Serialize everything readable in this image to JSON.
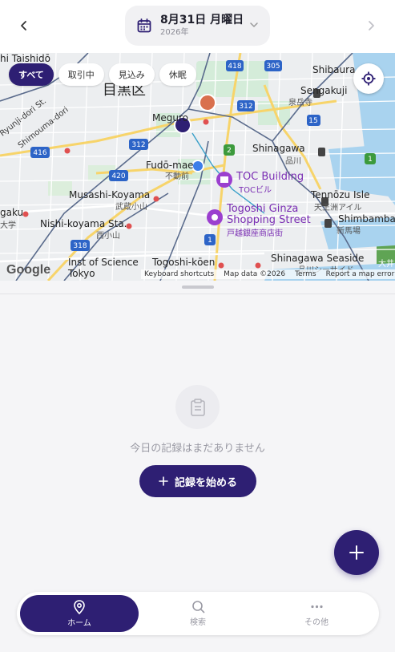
{
  "header": {
    "date": "8月31日 月曜日",
    "year": "2026年"
  },
  "filters": [
    "すべて",
    "取引中",
    "見込み",
    "休眠"
  ],
  "map": {
    "labels": {
      "taishido": "hi Taishidō",
      "meguro_ku": "目黒区",
      "shibaura": "Shibaura",
      "sengakuji": "Sengakuji",
      "sengakuji_jp": "泉岳寺",
      "meguro": "Meguro",
      "ryunji": "Ryunji-dori St.",
      "shimouma": "Shimouma-dori",
      "shinagawa": "Shinagawa",
      "shinagawa_jp": "品川",
      "fudomae": "Fudō-mae",
      "fudomae_jp": "不動前",
      "toc": "TOC Building",
      "toc_jp": "TOCビル",
      "musashi_koyama": "Musashi-Koyama",
      "musashi_koyama_jp": "武蔵小山",
      "tennozu": "Tennōzu Isle",
      "tennozu_jp": "天王洲アイル",
      "togoshi_ginza": "Togoshi Ginza",
      "shopping_street": "Shopping Street",
      "togoshi_jp": "戸越銀座商店街",
      "gaku": "gaku",
      "daigaku": "大学",
      "nishi_koyama": "Nishi-koyama Sta.",
      "nishi_koyama_jp": "西小山",
      "shinbamba": "Shimbamba",
      "shinbamba_jp": "新馬場",
      "inst": "Inst of Science",
      "tokyo": "Tokyo",
      "togoshi_koen": "Togoshi-kōen",
      "shinagawa_seaside": "Shinagawa Seaside",
      "seaside_jp": "品川シーサイド",
      "oi": "大井"
    },
    "routes": [
      "418",
      "305",
      "312",
      "15",
      "416",
      "312",
      "2",
      "420",
      "1",
      "318",
      "1"
    ],
    "google": "Google",
    "attribution": [
      "Keyboard shortcuts",
      "Map data ©2026",
      "Terms",
      "Report a map error"
    ]
  },
  "empty_state": {
    "message": "今日の記録はまだありません",
    "button": "記録を始める"
  },
  "bottom_nav": [
    {
      "label": "ホーム",
      "icon": "location-pin-icon"
    },
    {
      "label": "検索",
      "icon": "search-icon"
    },
    {
      "label": "その他",
      "icon": "more-dots-icon"
    }
  ],
  "colors": {
    "primary": "#2e1f73",
    "marker_orange": "#d9704e",
    "marker_navy": "#2e1f73",
    "marker_blue": "#3d7ee8",
    "poi_purple": "#9b3fcf"
  }
}
